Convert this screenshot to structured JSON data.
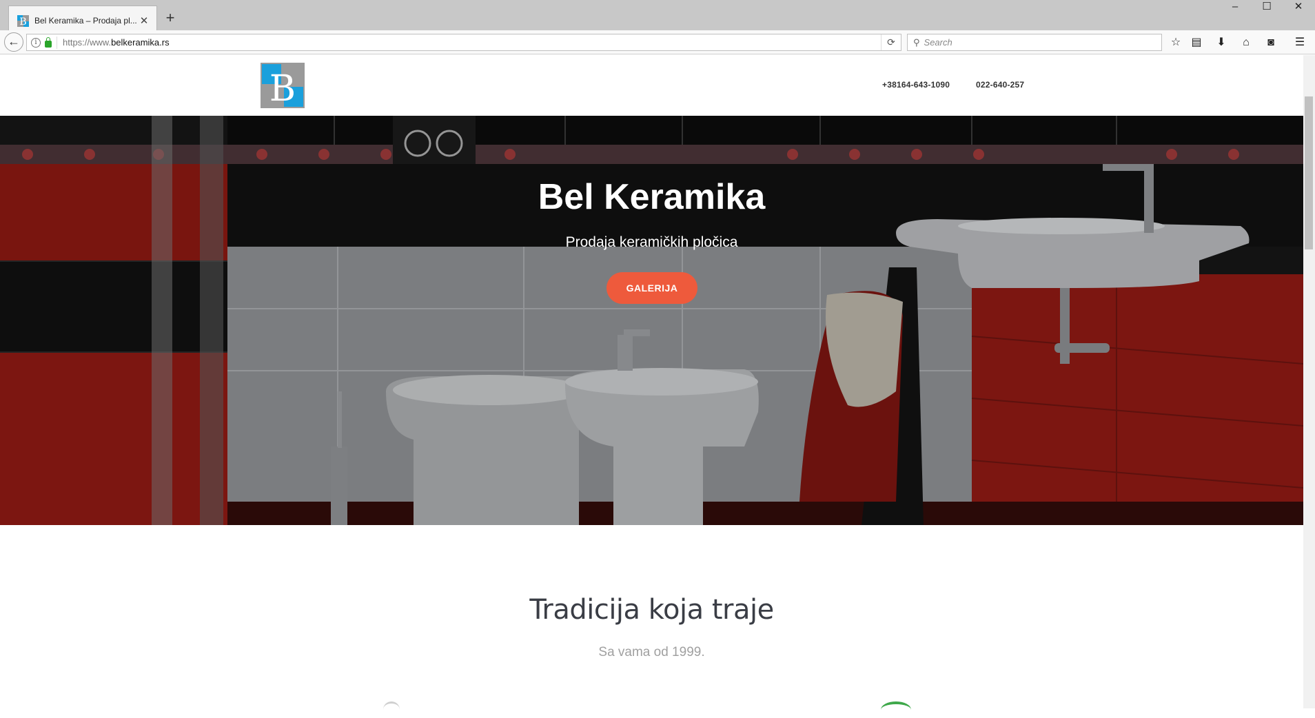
{
  "browser": {
    "tab_title": "Bel Keramika – Prodaja pl...",
    "url_prefix": "https://www.",
    "url_domain": "belkeramika.rs",
    "search_placeholder": "Search"
  },
  "site": {
    "logo_letter": "B",
    "phones": [
      "+38164-643-1090",
      "022-640-257"
    ],
    "hero": {
      "title": "Bel Keramika",
      "subtitle": "Prodaja keramičkih pločica",
      "button": "GALERIJA"
    },
    "section": {
      "title": "Tradicija koja traje",
      "subtitle": "Sa vama od 1999."
    }
  },
  "colors": {
    "accent": "#ee5a3c",
    "logo_blue": "#1aa0dc",
    "logo_gray": "#9a9a9a",
    "tile_red": "#b81e14"
  }
}
